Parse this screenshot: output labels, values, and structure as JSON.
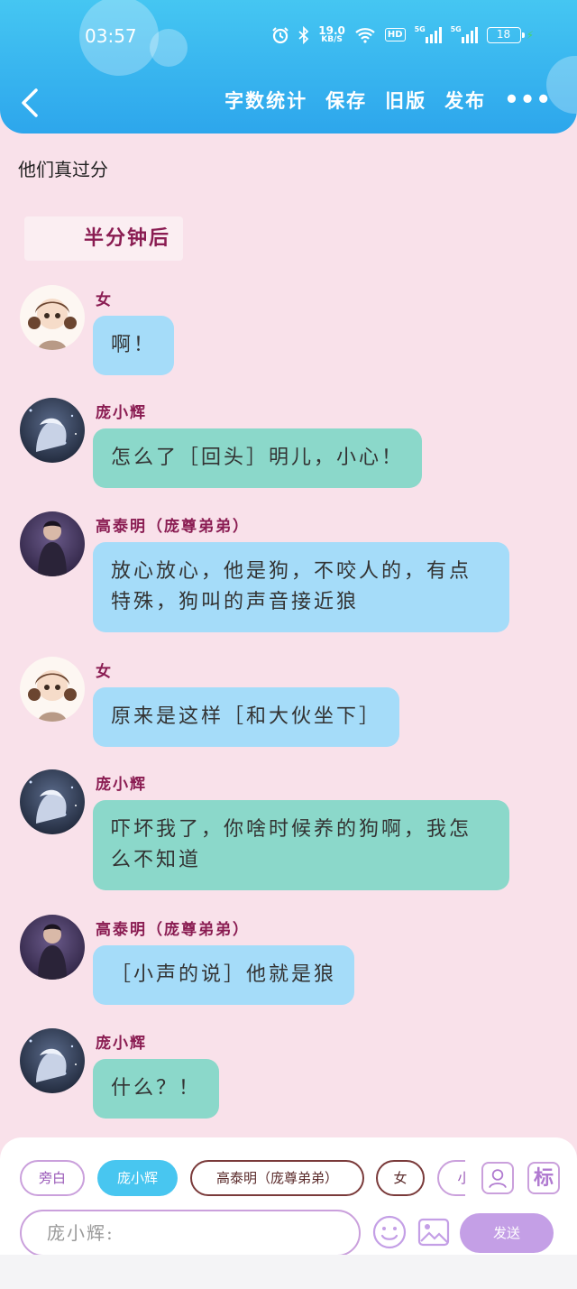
{
  "status": {
    "time": "03:57",
    "speed": "19.0",
    "speed_unit": "KB/S",
    "hd": "HD",
    "net1": "5G",
    "net2": "5G",
    "battery": "18"
  },
  "nav": {
    "word_count": "字数统计",
    "save": "保存",
    "old_version": "旧版",
    "publish": "发布",
    "more": "•••"
  },
  "doc_title": "他们真过分",
  "time_note": "半分钟后",
  "messages": [
    {
      "speaker": "女",
      "text": "啊！",
      "color": "#a5dcf9"
    },
    {
      "speaker": "庞小辉",
      "text": "怎么了［回头］明儿，小心！",
      "color": "#8bd8ca"
    },
    {
      "speaker": "高泰明（庞尊弟弟）",
      "text_line1": "放心放心，他是狗，不咬人的，有点",
      "text_line2": "特殊，狗叫的声音接近狼",
      "color": "#a5dcf9"
    },
    {
      "speaker": "女",
      "text": "原来是这样［和大伙坐下］",
      "color": "#a5dcf9"
    },
    {
      "speaker": "庞小辉",
      "text_line1": "吓坏我了，你啥时候养的狗啊，我怎",
      "text_line2": "么不知道",
      "color": "#8bd8ca"
    },
    {
      "speaker": "高泰明（庞尊弟弟）",
      "text": "［小声的说］他就是狼",
      "color": "#a5dcf9"
    },
    {
      "speaker": "庞小辉",
      "text": "什么？！",
      "color": "#8bd8ca"
    }
  ],
  "composer": {
    "chips": [
      "旁白",
      "庞小辉",
      "高泰明（庞尊弟弟）",
      "女",
      "小"
    ],
    "tag_label": "标",
    "input_value": "庞小辉:",
    "send_label": "发送"
  }
}
